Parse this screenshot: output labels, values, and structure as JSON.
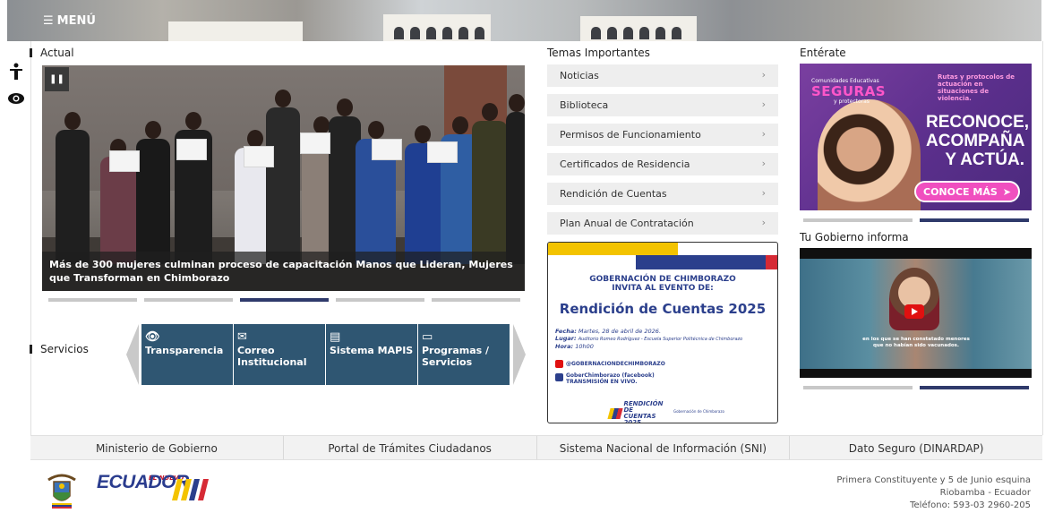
{
  "header": {
    "menu_label": "MENÚ"
  },
  "accessibility": {
    "icons": [
      "person-accessibility-icon",
      "eye-icon"
    ]
  },
  "actual": {
    "title": "Actual",
    "caption": "Más de 300 mujeres culminan proceso de capacitación Manos que Lideran, Mujeres que Transforman en Chimborazo",
    "active_slide": 3,
    "slide_count": 5
  },
  "servicios": {
    "title": "Servicios",
    "items": [
      {
        "label": "Transparencia",
        "icon": "eye-icon"
      },
      {
        "label": "Correo Institucional",
        "icon": "envelope-icon"
      },
      {
        "label": "Sistema MAPIS",
        "icon": "book-icon"
      },
      {
        "label": "Programas / Servicios",
        "icon": "folder-icon"
      }
    ]
  },
  "temas": {
    "title": "Temas Importantes",
    "items": [
      "Noticias",
      "Biblioteca",
      "Permisos de Funcionamiento",
      "Certificados de Residencia",
      "Rendición de Cuentas",
      "Plan Anual de Contratación"
    ],
    "chevron": "›"
  },
  "poster": {
    "org": "GOBERNACIÓN DE CHIMBORAZO",
    "invite": "INVITA AL EVENTO DE:",
    "event": "Rendición de Cuentas 2025",
    "fecha_label": "Fecha:",
    "fecha": "Martes, 28 de abril de 2026.",
    "lugar_label": "Lugar:",
    "lugar": "Auditorio Romeo Rodríguez - Escuela Superior Politécnica de Chimborazo",
    "hora_label": "Hora:",
    "hora": "10h00",
    "youtube": "@GOBERNACIONDECHIMBORAZO",
    "facebook": "GoberChimborazo (facebook)",
    "live": "TRANSMISIÓN EN VIVO.",
    "logo_text": "RENDICIÓN DE CUENTAS 2025",
    "logo_sub": "Gobernación de Chimborazo"
  },
  "enterate": {
    "title": "Entérate",
    "small1": "Comunidades Educativas",
    "big": "SEGURAS",
    "small2": "y protectoras",
    "right_top": "Rutas y protocolos de actuación en situaciones de violencia.",
    "line1": "RECONOCE,",
    "line2": "ACOMPAÑA",
    "line3": "Y ACTÚA.",
    "cta": "CONOCE MÁS",
    "active_slide": 2,
    "slide_count": 2
  },
  "gobierno": {
    "title": "Tu Gobierno informa",
    "subtitle": "en los que se han constatado menores que no habían sido vacunados.",
    "active_slide": 2,
    "slide_count": 2
  },
  "footer": {
    "links": [
      "Ministerio de Gobierno",
      "Portal de Trámites Ciudadanos",
      "Sistema Nacional de Información (SNI)",
      "Dato Seguro (DINARDAP)"
    ],
    "logo_small": "EL NUEVO",
    "logo": "ECUADOR",
    "address1": "Primera Constituyente y 5 de Junio esquina",
    "address2": "Riobamba - Ecuador",
    "phone": "Teléfono: 593-03 2960-205"
  },
  "colors": {
    "navy": "#2f3a6b",
    "service_blue": "#2f5672",
    "pink": "#f04fbf",
    "purple": "#5b2f8c"
  }
}
